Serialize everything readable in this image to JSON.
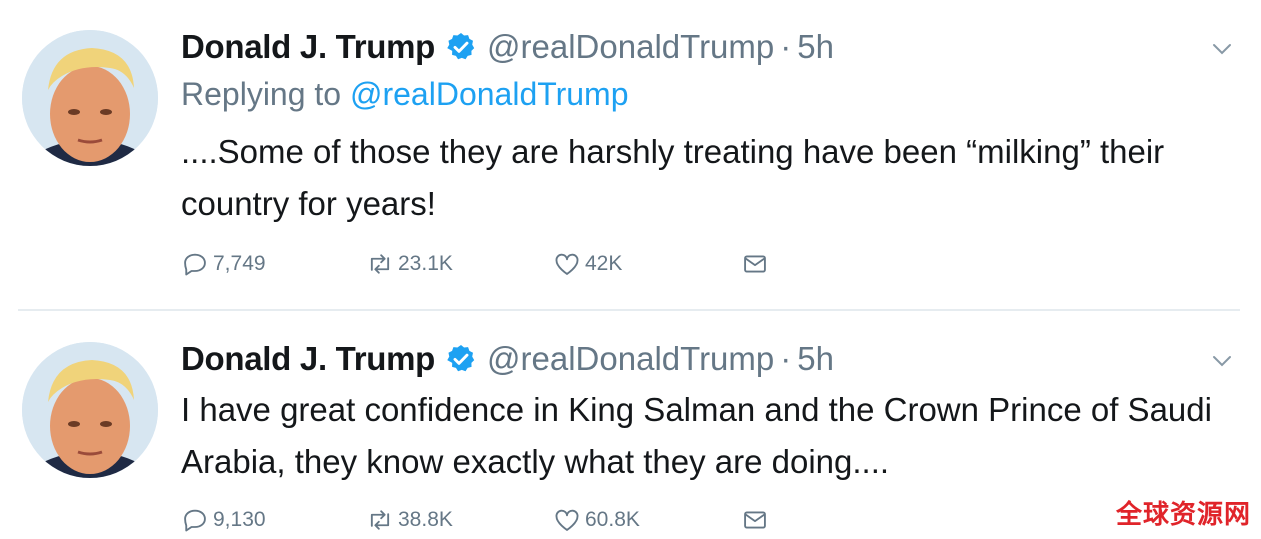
{
  "colors": {
    "text": "#14171a",
    "secondary": "#657786",
    "link": "#1da1f2",
    "divider": "#e6ecf0",
    "watermark": "#e0242a"
  },
  "tweets": [
    {
      "name": "Donald J. Trump",
      "handle": "@realDonaldTrump",
      "dot": "·",
      "time": "5h",
      "reply_prefix": "Replying to ",
      "reply_to": "@realDonaldTrump",
      "text": "....Some of those they are harshly treating have been “milking” their country for years!",
      "replies": "7,749",
      "retweets": "23.1K",
      "likes": "42K"
    },
    {
      "name": "Donald J. Trump",
      "handle": "@realDonaldTrump",
      "dot": "·",
      "time": "5h",
      "text": "I have great confidence in King Salman and the Crown Prince of Saudi Arabia, they know exactly what they are doing....",
      "replies": "9,130",
      "retweets": "38.8K",
      "likes": "60.8K"
    }
  ],
  "icons": {
    "verified": "verified-badge-icon",
    "caret": "chevron-down-icon",
    "reply": "reply-icon",
    "retweet": "retweet-icon",
    "like": "heart-icon",
    "dm": "envelope-icon"
  },
  "watermark": "全球资源网"
}
